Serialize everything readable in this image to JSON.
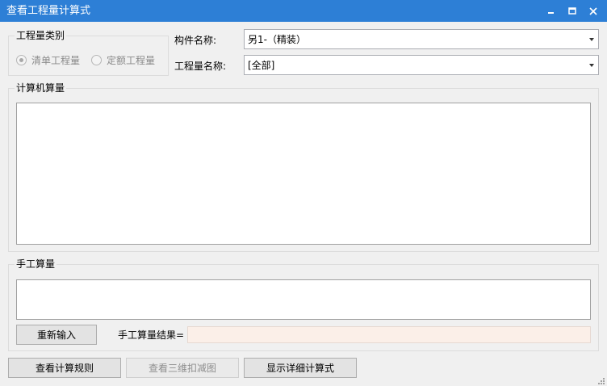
{
  "window": {
    "title": "查看工程量计算式"
  },
  "qty_category": {
    "legend": "工程量类别",
    "options": [
      {
        "label": "清单工程量",
        "checked": true
      },
      {
        "label": "定额工程量",
        "checked": false
      }
    ]
  },
  "component": {
    "label": "构件名称:",
    "value": "另1-（精装）"
  },
  "quantity_name": {
    "label": "工程量名称:",
    "value": "[全部]"
  },
  "computer_calc": {
    "legend": "计算机算量"
  },
  "manual_calc": {
    "legend": "手工算量",
    "reenter_button": "重新输入",
    "result_label": "手工算量结果="
  },
  "footer": {
    "view_rules_button": "查看计算规则",
    "view_3d_button": "查看三维扣减图",
    "show_detail_button": "显示详细计算式"
  },
  "icons": {
    "minimize": "minimize-icon",
    "maximize": "maximize-icon",
    "close": "close-icon",
    "dropdown": "chevron-down-icon",
    "resize": "resize-grip-icon"
  },
  "colors": {
    "titlebar": "#2d7fd6",
    "result_field_bg": "#fbefe8"
  }
}
